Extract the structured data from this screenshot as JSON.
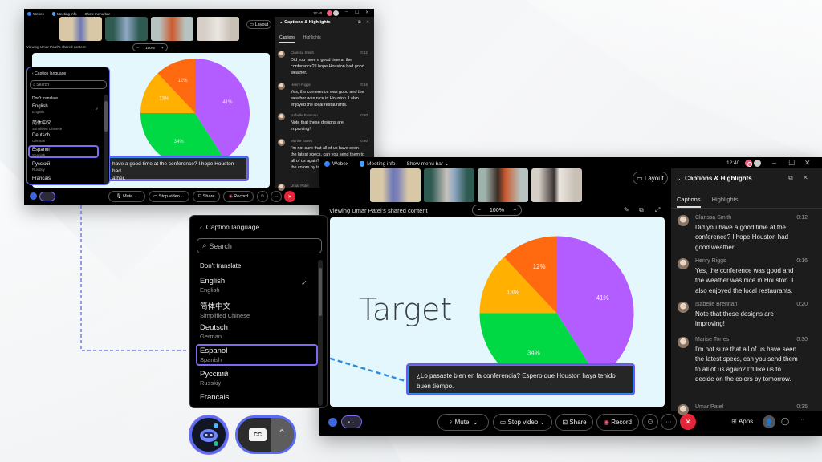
{
  "app": {
    "name": "Webex",
    "meeting_info": "Meeting info",
    "show_menu_bar": "Show menu bar",
    "clock": "12:40",
    "layout_label": "Layout",
    "viewing": "Viewing Umar Patel's shared content",
    "zoom_level": "100%",
    "zoom_minus": "−",
    "zoom_plus": "+",
    "window_controls": {
      "minimize": "–",
      "maximize": "☐",
      "close": "✕"
    }
  },
  "thumbnails": [
    {
      "name": "participant-1",
      "colors": [
        "#d9c8a6",
        "#6e79b8"
      ]
    },
    {
      "name": "participant-2",
      "colors": [
        "#2e5a52",
        "#8fa8c4"
      ]
    },
    {
      "name": "participant-3",
      "colors": [
        "#b6c3c0",
        "#cc5a30"
      ]
    },
    {
      "name": "participant-4",
      "colors": [
        "#d5cfc7",
        "#eae6e0"
      ]
    }
  ],
  "slide": {
    "title": "Target",
    "caption_translated": "¿Lo pasaste bien en la conferencia? Espero que Houston haya tenido buen tiempo.",
    "caption_original_partial": "have a good time at the conference? I hope Houston had",
    "caption_original_partial2": "ather."
  },
  "chart_data": {
    "type": "pie",
    "title": "Target",
    "slices": [
      {
        "label": "41%",
        "value": 41,
        "color": "#b35cff"
      },
      {
        "label": "34%",
        "value": 34,
        "color": "#00d844"
      },
      {
        "label": "13%",
        "value": 13,
        "color": "#ffb000"
      },
      {
        "label": "12%",
        "value": 12,
        "color": "#ff6a10"
      }
    ]
  },
  "captions_panel": {
    "title": "Captions & Highlights",
    "tabs": [
      "Captions",
      "Highlights"
    ],
    "active_tab": "Captions",
    "entries": [
      {
        "name": "Clarissa Smith",
        "time": "0:12",
        "text": "Did you have a good time at the conference? I hope Houston had good weather."
      },
      {
        "name": "Henry Riggs",
        "time": "0:16",
        "text": "Yes, the conference was good and the weather was nice in Houston. I also enjoyed the local restaurants."
      },
      {
        "name": "Isabelle Brennan",
        "time": "0:20",
        "text": "Note that these designs are improving!"
      },
      {
        "name": "Marise Torres",
        "time": "0:30",
        "text": "I'm not sure that all of us have seen the latest specs, can you send them to all of us again? I'd like us to decide on the colors by tomorrow."
      },
      {
        "name": "Umar Patel",
        "time": "0:35",
        "text": ""
      }
    ]
  },
  "controls": {
    "mute": "Mute",
    "stop_video": "Stop video",
    "share": "Share",
    "record": "Record",
    "apps": "Apps",
    "more": "···",
    "end": "✕"
  },
  "caption_language_menu": {
    "title": "Caption language",
    "search_placeholder": "Search",
    "dont_translate": "Don't translate",
    "languages": [
      {
        "name": "English",
        "sub": "English",
        "checked": true
      },
      {
        "name": "简体中文",
        "sub": "Simplified Chinese"
      },
      {
        "name": "Deutsch",
        "sub": "German"
      },
      {
        "name": "Espanol",
        "sub": "Spanish",
        "highlighted": true
      },
      {
        "name": "Русский",
        "sub": "Russkiy"
      },
      {
        "name": "Francais",
        "sub": ""
      }
    ]
  },
  "floating": {
    "cc_label": "CC"
  }
}
